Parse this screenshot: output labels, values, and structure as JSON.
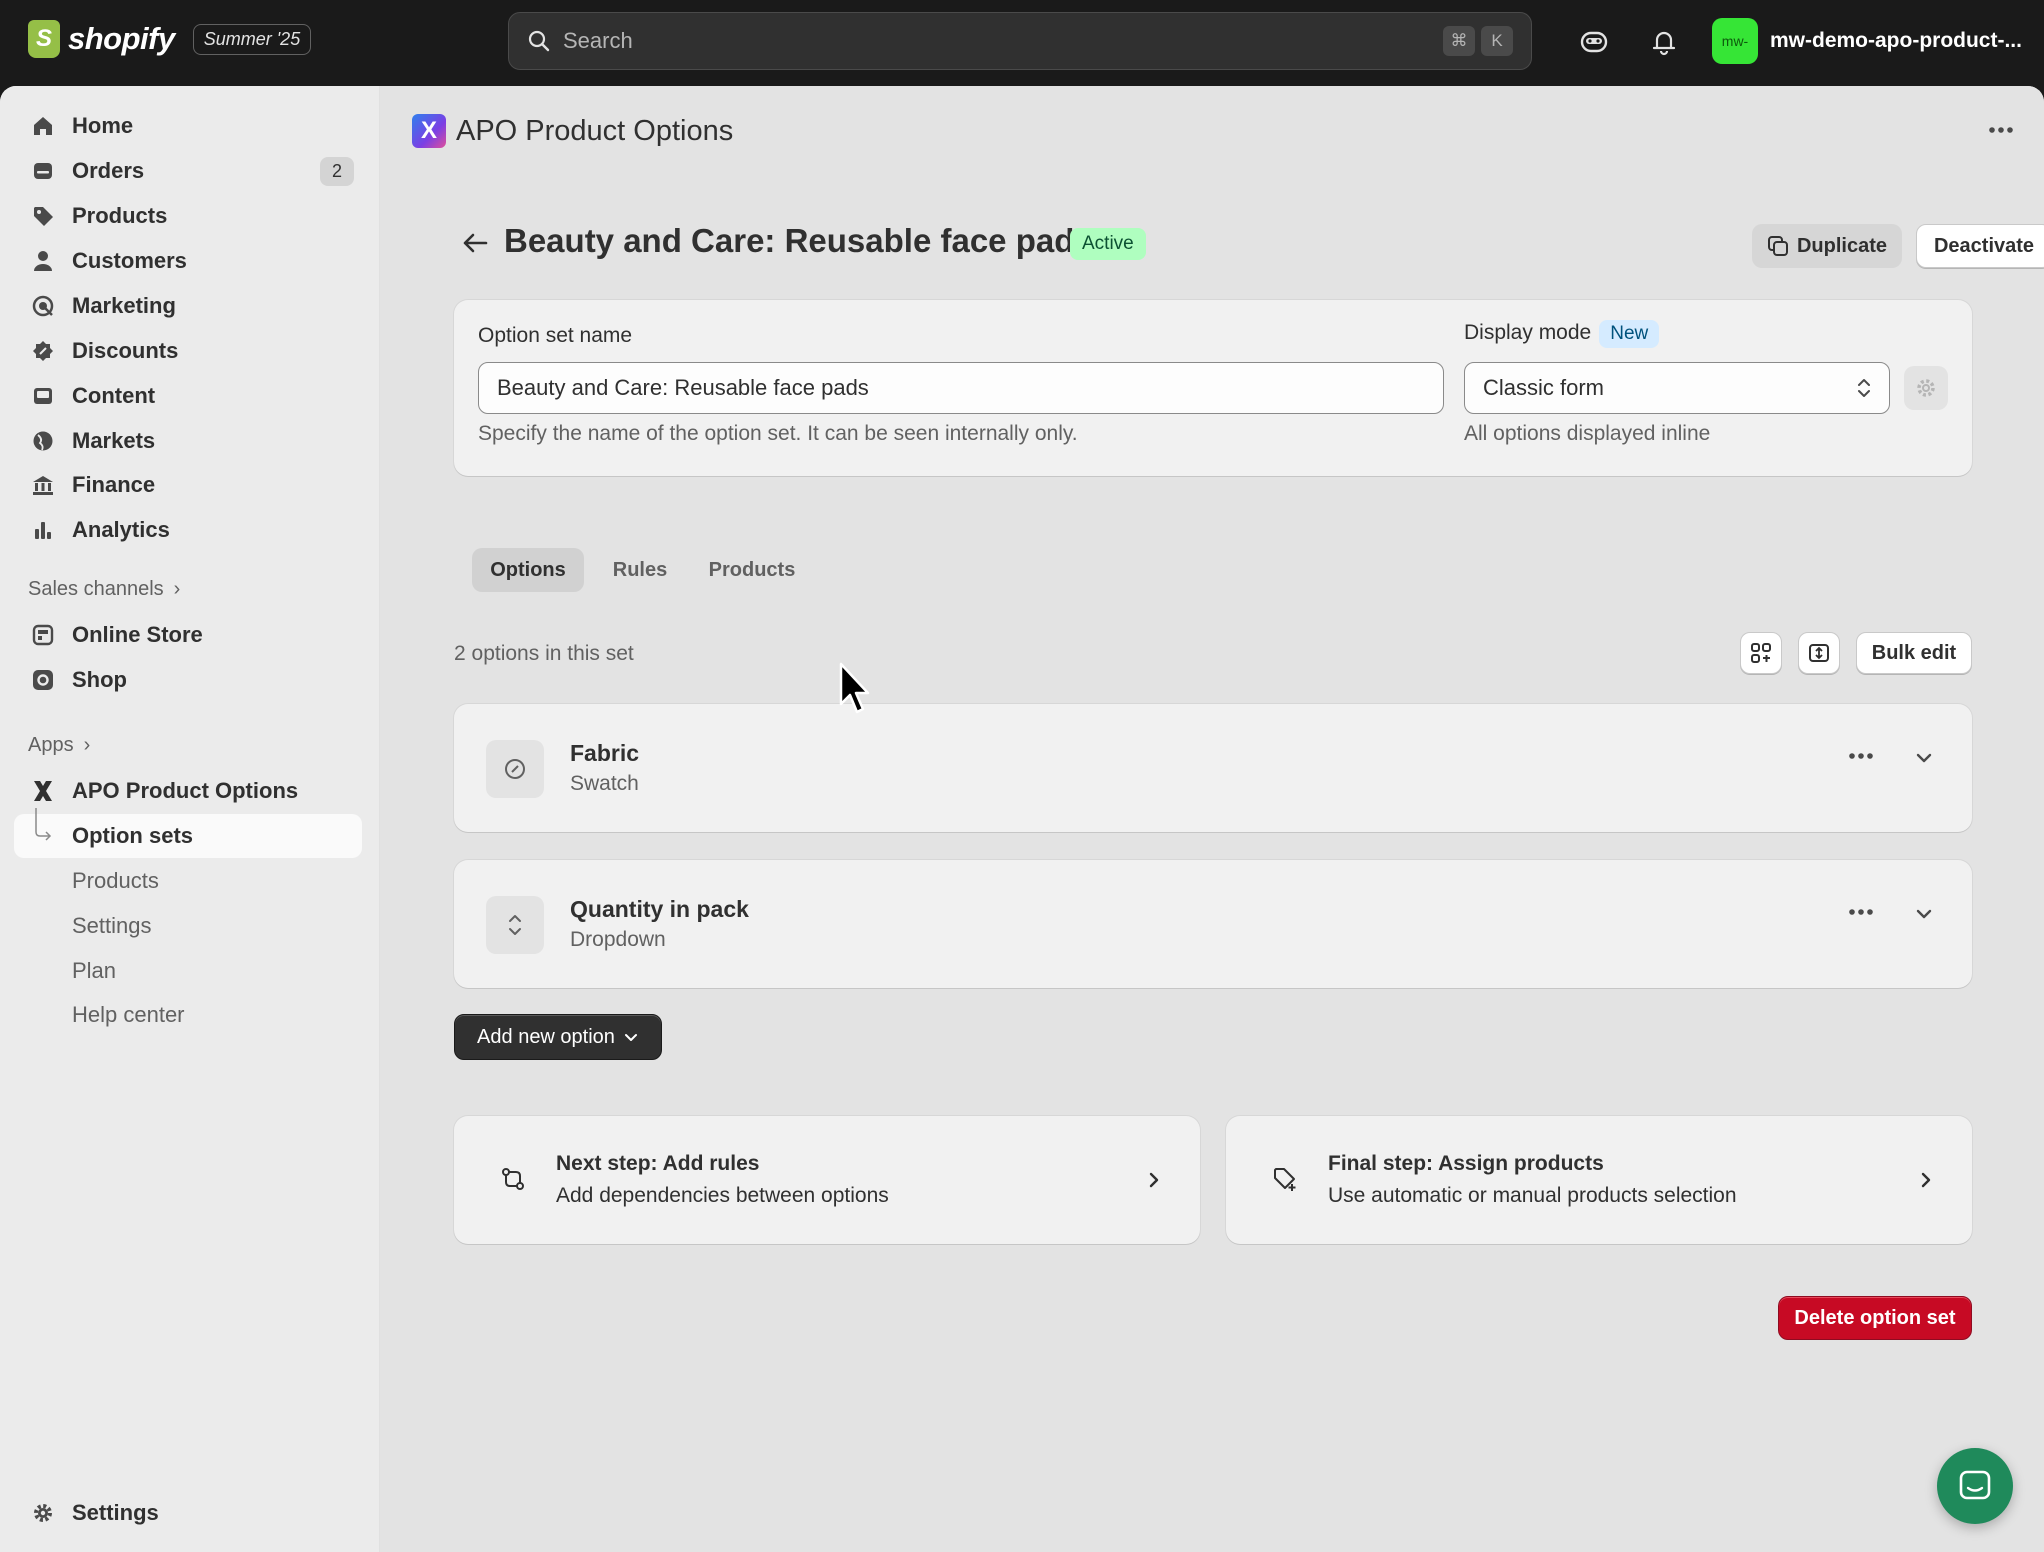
{
  "topbar": {
    "brand": "shopify",
    "edition": "Summer '25",
    "search_placeholder": "Search",
    "shortcut_mod": "⌘",
    "shortcut_key": "K",
    "store_avatar": "mw-",
    "store_name": "mw-demo-apo-product-..."
  },
  "sidebar": {
    "items": [
      {
        "label": "Home",
        "icon": "home-icon"
      },
      {
        "label": "Orders",
        "icon": "orders-icon",
        "count": "2"
      },
      {
        "label": "Products",
        "icon": "tag-icon"
      },
      {
        "label": "Customers",
        "icon": "person-icon"
      },
      {
        "label": "Marketing",
        "icon": "target-icon"
      },
      {
        "label": "Discounts",
        "icon": "discount-icon"
      },
      {
        "label": "Content",
        "icon": "content-icon"
      },
      {
        "label": "Markets",
        "icon": "globe-icon"
      },
      {
        "label": "Finance",
        "icon": "bank-icon"
      },
      {
        "label": "Analytics",
        "icon": "bar-chart-icon"
      }
    ],
    "sales_channels_label": "Sales channels",
    "channels": [
      {
        "label": "Online Store",
        "icon": "store-icon"
      },
      {
        "label": "Shop",
        "icon": "shop-icon"
      }
    ],
    "apps_label": "Apps",
    "app_name": "APO Product Options",
    "app_subitems": [
      {
        "label": "Option sets",
        "active": true
      },
      {
        "label": "Products"
      },
      {
        "label": "Settings"
      },
      {
        "label": "Plan"
      },
      {
        "label": "Help center"
      }
    ],
    "settings_label": "Settings"
  },
  "app_header": {
    "logo_letter": "X",
    "title": "APO Product Options"
  },
  "page": {
    "title": "Beauty and Care: Reusable face pads",
    "status": "Active",
    "duplicate_label": "Duplicate",
    "deactivate_label": "Deactivate"
  },
  "settings_card": {
    "name_label": "Option set name",
    "name_value": "Beauty and Care: Reusable face pads",
    "name_help": "Specify the name of the option set. It can be seen internally only.",
    "display_label": "Display mode",
    "display_badge": "New",
    "display_value": "Classic form",
    "display_help": "All options displayed inline"
  },
  "tabs": [
    {
      "label": "Options",
      "selected": true
    },
    {
      "label": "Rules"
    },
    {
      "label": "Products"
    }
  ],
  "options_section": {
    "count_text": "2 options in this set",
    "bulk_edit_label": "Bulk edit",
    "options": [
      {
        "title": "Fabric",
        "type": "Swatch",
        "icon": "link-icon"
      },
      {
        "title": "Quantity in pack",
        "type": "Dropdown",
        "icon": "selector-icon"
      }
    ],
    "add_new_label": "Add new option"
  },
  "steps": [
    {
      "title": "Next step: Add rules",
      "subtitle": "Add dependencies between options",
      "icon": "rules-icon"
    },
    {
      "title": "Final step: Assign products",
      "subtitle": "Use automatic or manual products selection",
      "icon": "tag-plus-icon"
    }
  ],
  "delete_label": "Delete option set",
  "colors": {
    "topbar": "#1a1a1a",
    "active_badge": "#affebf",
    "new_badge": "#d5ebff",
    "danger": "#c70a24",
    "chat": "#1f8a5b",
    "store_avatar": "#36e536"
  }
}
